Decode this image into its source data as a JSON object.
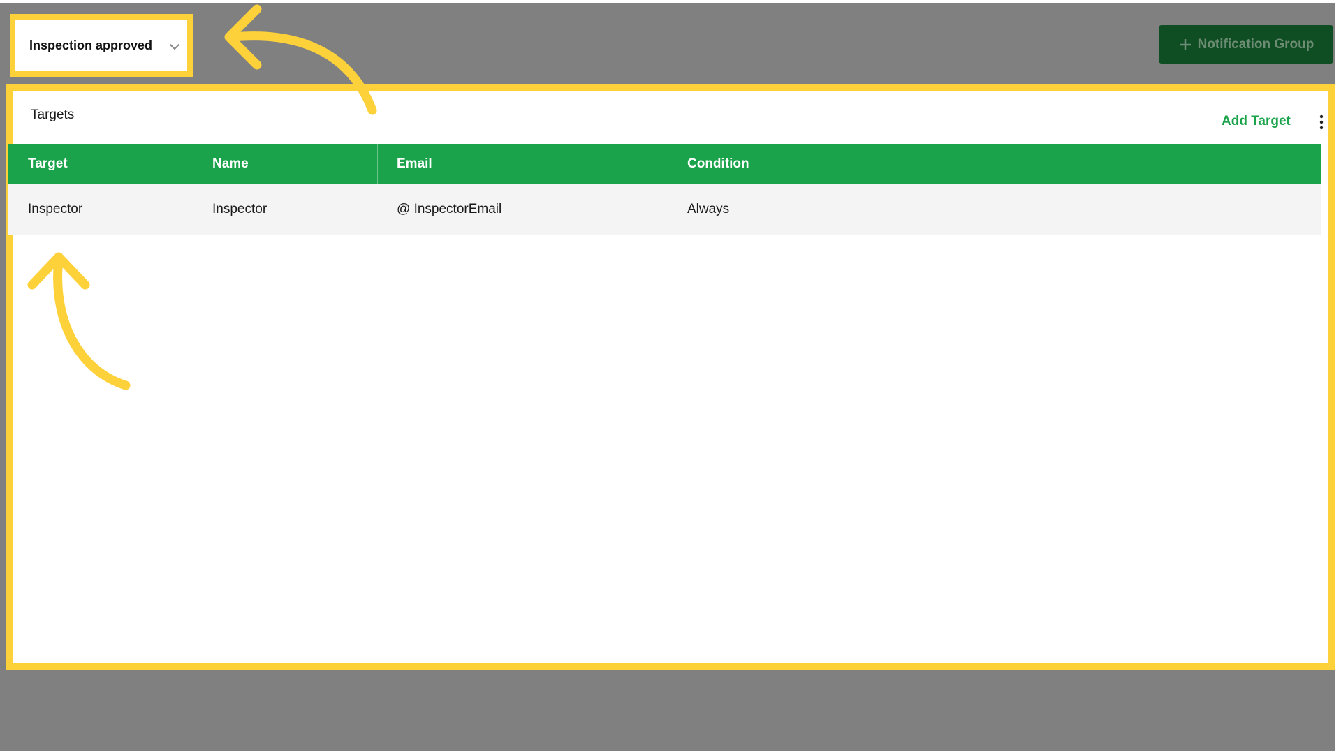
{
  "event_selector": {
    "value": "Inspection approved",
    "icon": "chevron-down-icon"
  },
  "toolbar": {
    "notification_group_label": "Notification Group",
    "notification_group_icon": "plus-icon"
  },
  "panel": {
    "title": "Targets",
    "add_target_label": "Add Target",
    "more_icon": "kebab-menu-icon"
  },
  "table": {
    "columns": [
      "Target",
      "Name",
      "Email",
      "Condition"
    ],
    "rows": [
      [
        "Inspector",
        "Inspector",
        "@ InspectorEmail",
        "Always"
      ]
    ]
  },
  "colors": {
    "accent_green": "#1AA34A",
    "dark_green_button": "#0F4D23",
    "highlight_yellow": "#FDD13A",
    "backdrop_gray": "#808080"
  }
}
